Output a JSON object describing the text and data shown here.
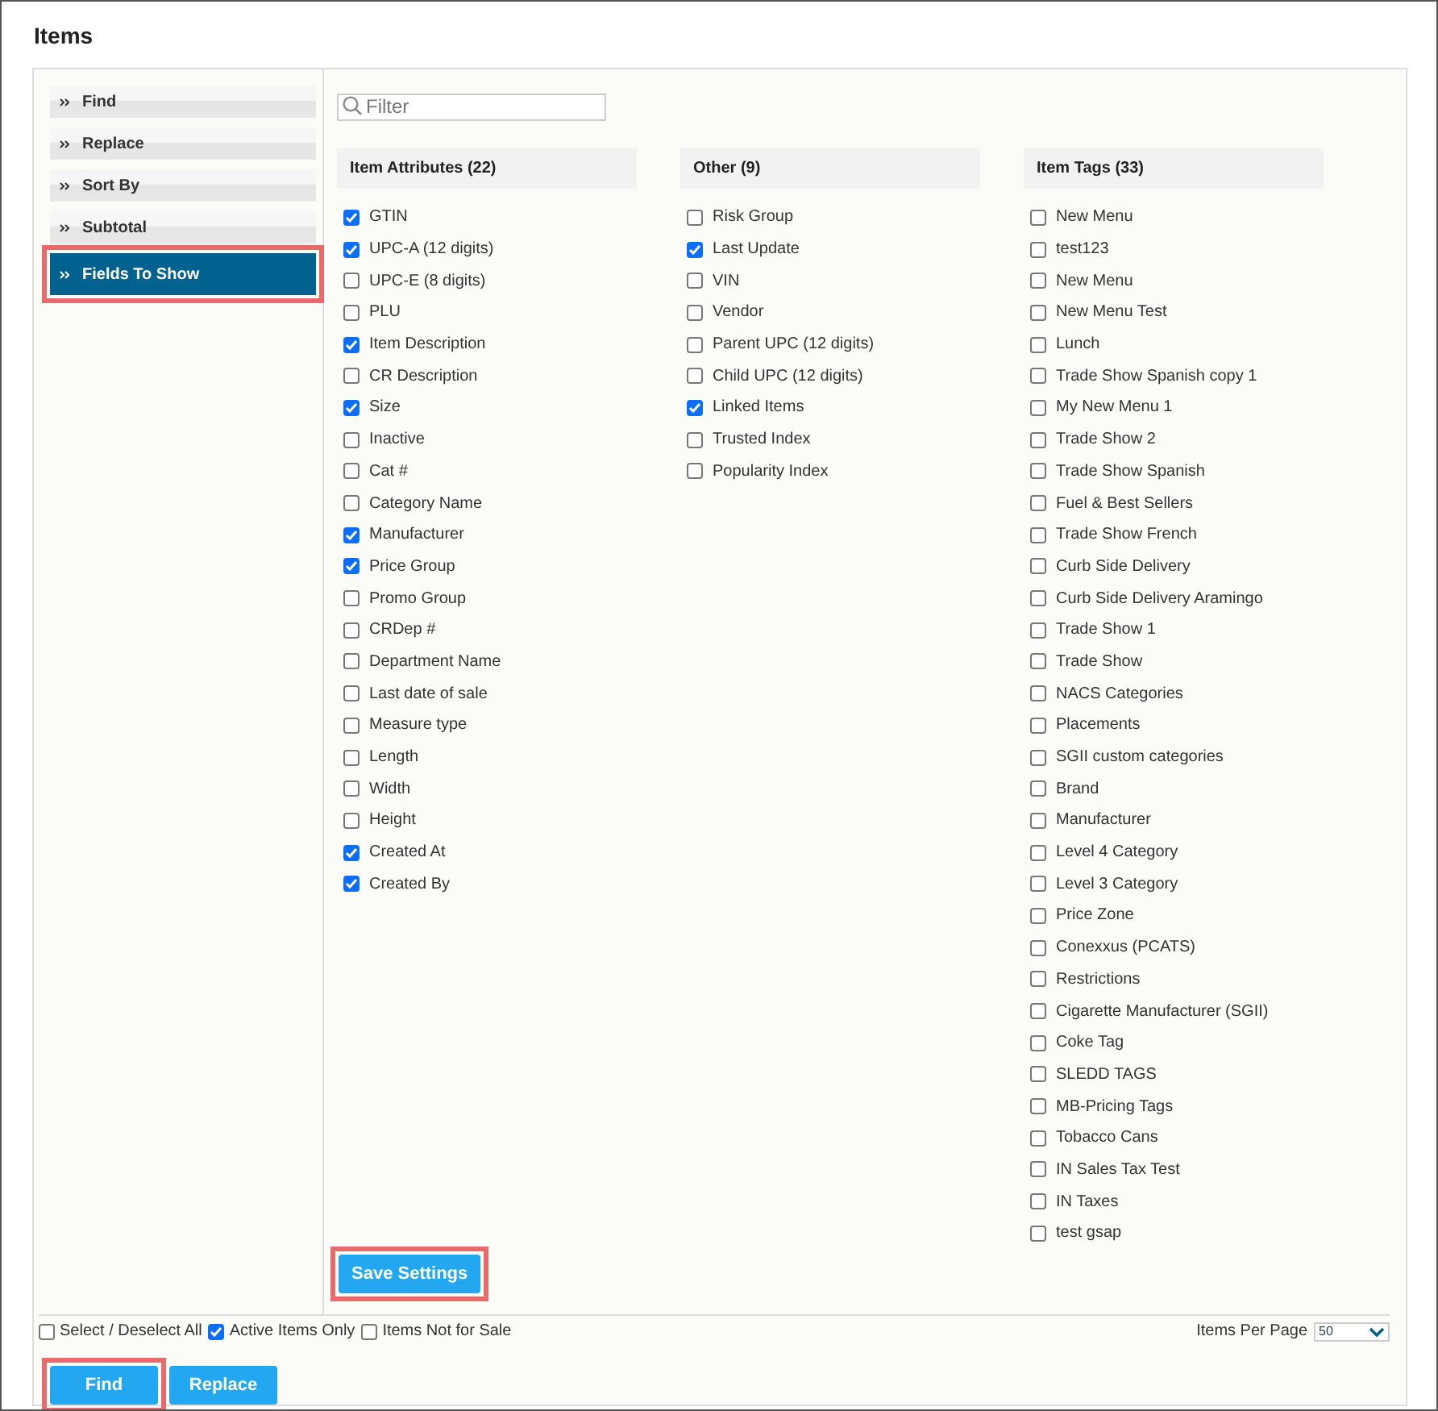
{
  "title": "Items",
  "sidebar": [
    {
      "label": "Find",
      "selected": false,
      "highlighted": false
    },
    {
      "label": "Replace",
      "selected": false,
      "highlighted": false
    },
    {
      "label": "Sort By",
      "selected": false,
      "highlighted": false
    },
    {
      "label": "Subtotal",
      "selected": false,
      "highlighted": false
    },
    {
      "label": "Fields To Show",
      "selected": true,
      "highlighted": true
    }
  ],
  "filter": {
    "placeholder": "Filter"
  },
  "groups": [
    {
      "title": "Item Attributes (22)",
      "fields": [
        {
          "label": "GTIN",
          "checked": true
        },
        {
          "label": "UPC-A (12 digits)",
          "checked": true
        },
        {
          "label": "UPC-E (8 digits)",
          "checked": false
        },
        {
          "label": "PLU",
          "checked": false
        },
        {
          "label": "Item Description",
          "checked": true
        },
        {
          "label": "CR Description",
          "checked": false
        },
        {
          "label": "Size",
          "checked": true
        },
        {
          "label": "Inactive",
          "checked": false
        },
        {
          "label": "Cat #",
          "checked": false
        },
        {
          "label": "Category Name",
          "checked": false
        },
        {
          "label": "Manufacturer",
          "checked": true
        },
        {
          "label": "Price Group",
          "checked": true
        },
        {
          "label": "Promo Group",
          "checked": false
        },
        {
          "label": "CRDep #",
          "checked": false
        },
        {
          "label": "Department Name",
          "checked": false
        },
        {
          "label": "Last date of sale",
          "checked": false
        },
        {
          "label": "Measure type",
          "checked": false
        },
        {
          "label": "Length",
          "checked": false
        },
        {
          "label": "Width",
          "checked": false
        },
        {
          "label": "Height",
          "checked": false
        },
        {
          "label": "Created At",
          "checked": true
        },
        {
          "label": "Created By",
          "checked": true
        }
      ]
    },
    {
      "title": "Other (9)",
      "fields": [
        {
          "label": "Risk Group",
          "checked": false
        },
        {
          "label": "Last Update",
          "checked": true
        },
        {
          "label": "VIN",
          "checked": false
        },
        {
          "label": "Vendor",
          "checked": false
        },
        {
          "label": "Parent UPC (12 digits)",
          "checked": false
        },
        {
          "label": "Child UPC (12 digits)",
          "checked": false
        },
        {
          "label": "Linked Items",
          "checked": true
        },
        {
          "label": "Trusted Index",
          "checked": false
        },
        {
          "label": "Popularity Index",
          "checked": false
        }
      ]
    },
    {
      "title": "Item Tags (33)",
      "fields": [
        {
          "label": "New Menu",
          "checked": false
        },
        {
          "label": "test123",
          "checked": false
        },
        {
          "label": "New Menu",
          "checked": false
        },
        {
          "label": "New Menu Test",
          "checked": false
        },
        {
          "label": "Lunch",
          "checked": false
        },
        {
          "label": "Trade Show Spanish copy 1",
          "checked": false
        },
        {
          "label": "My New Menu 1",
          "checked": false
        },
        {
          "label": "Trade Show 2",
          "checked": false
        },
        {
          "label": "Trade Show Spanish",
          "checked": false
        },
        {
          "label": "Fuel & Best Sellers",
          "checked": false
        },
        {
          "label": "Trade Show French",
          "checked": false
        },
        {
          "label": "Curb Side Delivery",
          "checked": false
        },
        {
          "label": "Curb Side Delivery Aramingo",
          "checked": false
        },
        {
          "label": "Trade Show 1",
          "checked": false
        },
        {
          "label": "Trade Show",
          "checked": false
        },
        {
          "label": "NACS Categories",
          "checked": false
        },
        {
          "label": "Placements",
          "checked": false
        },
        {
          "label": "SGII custom categories",
          "checked": false
        },
        {
          "label": "Brand",
          "checked": false
        },
        {
          "label": "Manufacturer",
          "checked": false
        },
        {
          "label": "Level 4 Category",
          "checked": false
        },
        {
          "label": "Level 3 Category",
          "checked": false
        },
        {
          "label": "Price Zone",
          "checked": false
        },
        {
          "label": "Conexxus (PCATS)",
          "checked": false
        },
        {
          "label": "Restrictions",
          "checked": false
        },
        {
          "label": "Cigarette Manufacturer (SGII)",
          "checked": false
        },
        {
          "label": "Coke Tag",
          "checked": false
        },
        {
          "label": "SLEDD TAGS",
          "checked": false
        },
        {
          "label": "MB-Pricing Tags",
          "checked": false
        },
        {
          "label": "Tobacco Cans",
          "checked": false
        },
        {
          "label": "IN Sales Tax Test",
          "checked": false
        },
        {
          "label": "IN Taxes",
          "checked": false
        },
        {
          "label": "test gsap",
          "checked": false
        }
      ]
    }
  ],
  "save_button": {
    "label": "Save Settings",
    "highlighted": true
  },
  "options": [
    {
      "label": "Select / Deselect All",
      "checked": false
    },
    {
      "label": "Active Items Only",
      "checked": true
    },
    {
      "label": "Items Not for Sale",
      "checked": false
    }
  ],
  "items_per_page": {
    "label": "Items Per Page",
    "value": "50"
  },
  "actions": [
    {
      "label": "Find",
      "highlighted": true
    },
    {
      "label": "Replace",
      "highlighted": false
    }
  ]
}
